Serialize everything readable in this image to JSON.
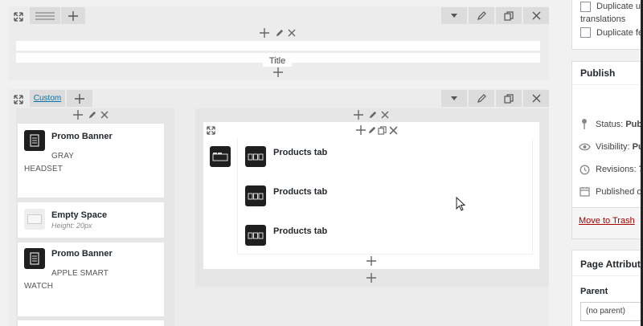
{
  "top_section": {
    "title_label": "Title"
  },
  "row2": {
    "tab_label": "Custom",
    "left_column": [
      {
        "type": "promo",
        "name": "Promo Banner",
        "subtitle_line1": "GRAY",
        "subtitle_line2": "HEADSET"
      },
      {
        "type": "empty",
        "name": "Empty Space",
        "meta": "Height: 20px"
      },
      {
        "type": "promo",
        "name": "Promo Banner",
        "subtitle_line1": "APPLE SMART",
        "subtitle_line2": "WATCH"
      }
    ],
    "tabs": [
      {
        "name": "Products tab"
      },
      {
        "name": "Products tab"
      },
      {
        "name": "Products tab"
      }
    ]
  },
  "sidebar": {
    "duplicate_up_label": "Duplicate up",
    "translations_label": "translations",
    "duplicate_fe_label": "Duplicate fe",
    "publish_title": "Publish",
    "status_label": "Status:",
    "status_value": "Publ",
    "visibility_label": "Visibility:",
    "visibility_value": "Pu",
    "revisions_label": "Revisions:",
    "revisions_value": "7",
    "published_label": "Published o",
    "move_to_trash": "Move to Trash",
    "page_attributes_title": "Page Attribute",
    "parent_label": "Parent",
    "parent_value": "(no parent)"
  },
  "colors": {
    "link": "#0073aa",
    "trash": "#a00",
    "icon_dark": "#1f1f1f"
  }
}
